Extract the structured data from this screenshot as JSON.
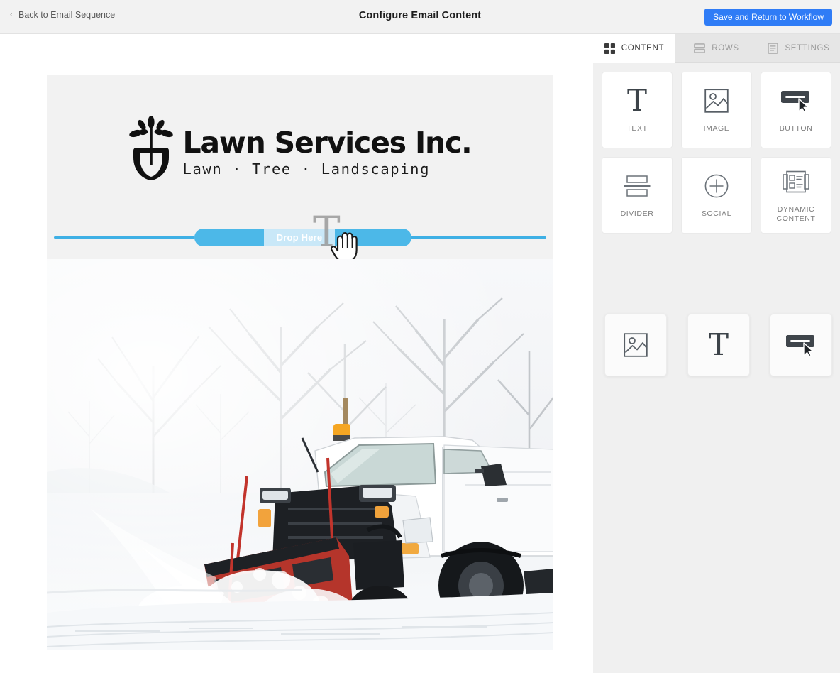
{
  "header": {
    "back_label": "Back to Email Sequence",
    "back_icon": "chevron-left-icon",
    "title": "Configure Email Content",
    "save_label": "Save and Return to Workflow",
    "accent_color": "#2f7cf6",
    "bar_color": "#f2f2f2"
  },
  "email": {
    "logo": {
      "icon": "plant-shovel-logo-icon",
      "name": "Lawn Services Inc.",
      "tagline": "Lawn  ·  Tree  ·  Landscaping"
    },
    "drop_indicator": {
      "label": "Drop Here",
      "line_color": "#3fb0e5",
      "pill_color": "#4cb8e8",
      "pill_track_color": "#c9e8f8",
      "dragged_block": "text-block",
      "cursor": "grab-hand-cursor"
    },
    "photo": {
      "alt": "White pickup truck with red snow plow clearing a snowy road",
      "snow_color": "#f4f6f8",
      "plow_color": "#b5352b",
      "truck_color": "#ffffff",
      "beacon_color": "#f5a623"
    }
  },
  "panel": {
    "tabs": [
      {
        "label": "CONTENT",
        "icon": "grid-squares-icon",
        "active": true
      },
      {
        "label": "ROWS",
        "icon": "rows-layout-icon",
        "active": false
      },
      {
        "label": "SETTINGS",
        "icon": "document-lines-icon",
        "active": false
      }
    ],
    "tiles": [
      {
        "label": "TEXT",
        "icon": "serif-t-icon"
      },
      {
        "label": "IMAGE",
        "icon": "picture-icon"
      },
      {
        "label": "BUTTON",
        "icon": "button-cursor-icon"
      },
      {
        "label": "DIVIDER",
        "icon": "divider-icon"
      },
      {
        "label": "SOCIAL",
        "icon": "plus-circle-icon"
      },
      {
        "label": "DYNAMIC CONTENT",
        "icon": "dynamic-content-icon"
      }
    ],
    "drag_previews": [
      {
        "icon": "picture-icon"
      },
      {
        "icon": "serif-t-icon"
      },
      {
        "icon": "button-cursor-icon"
      }
    ],
    "background_color": "#f0f0f0",
    "tabbar_color": "#e6e6e6"
  }
}
